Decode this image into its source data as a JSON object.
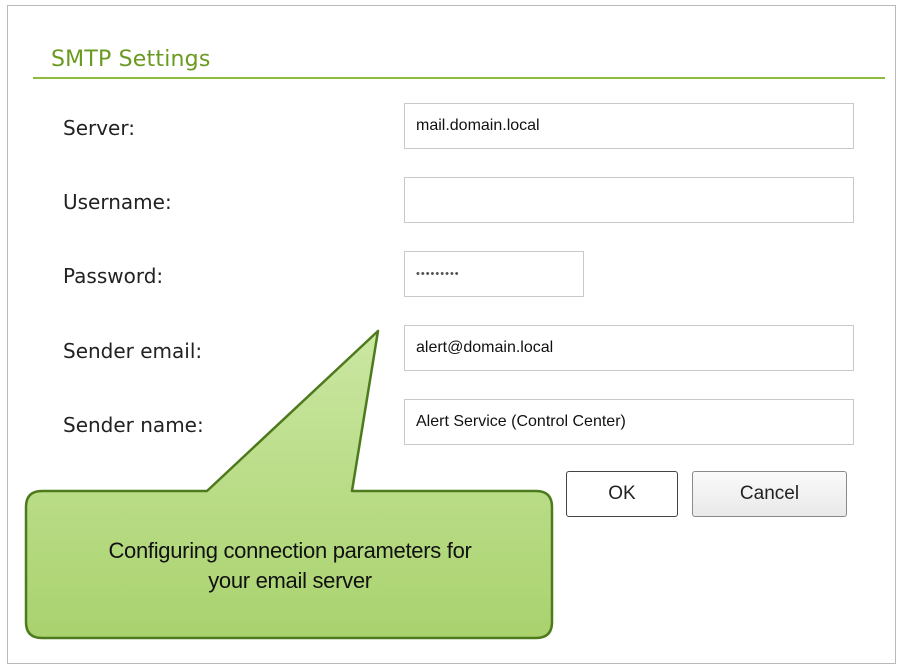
{
  "section": {
    "title": "SMTP Settings"
  },
  "form": {
    "server": {
      "label": "Server:",
      "value": "mail.domain.local"
    },
    "username": {
      "label": "Username:",
      "value": ""
    },
    "password": {
      "label": "Password:",
      "value": "•••••••••"
    },
    "sender_email": {
      "label": "Sender email:",
      "value": "alert@domain.local"
    },
    "sender_name": {
      "label": "Sender name:",
      "value": "Alert Service (Control Center)"
    }
  },
  "buttons": {
    "ok": "OK",
    "cancel": "Cancel"
  },
  "callout": {
    "line1": "Configuring connection parameters for",
    "line2": "your email server"
  },
  "colors": {
    "accent": "#6a9a1f",
    "callout_fill": "#b9dd86",
    "callout_border": "#4e7a1e"
  }
}
